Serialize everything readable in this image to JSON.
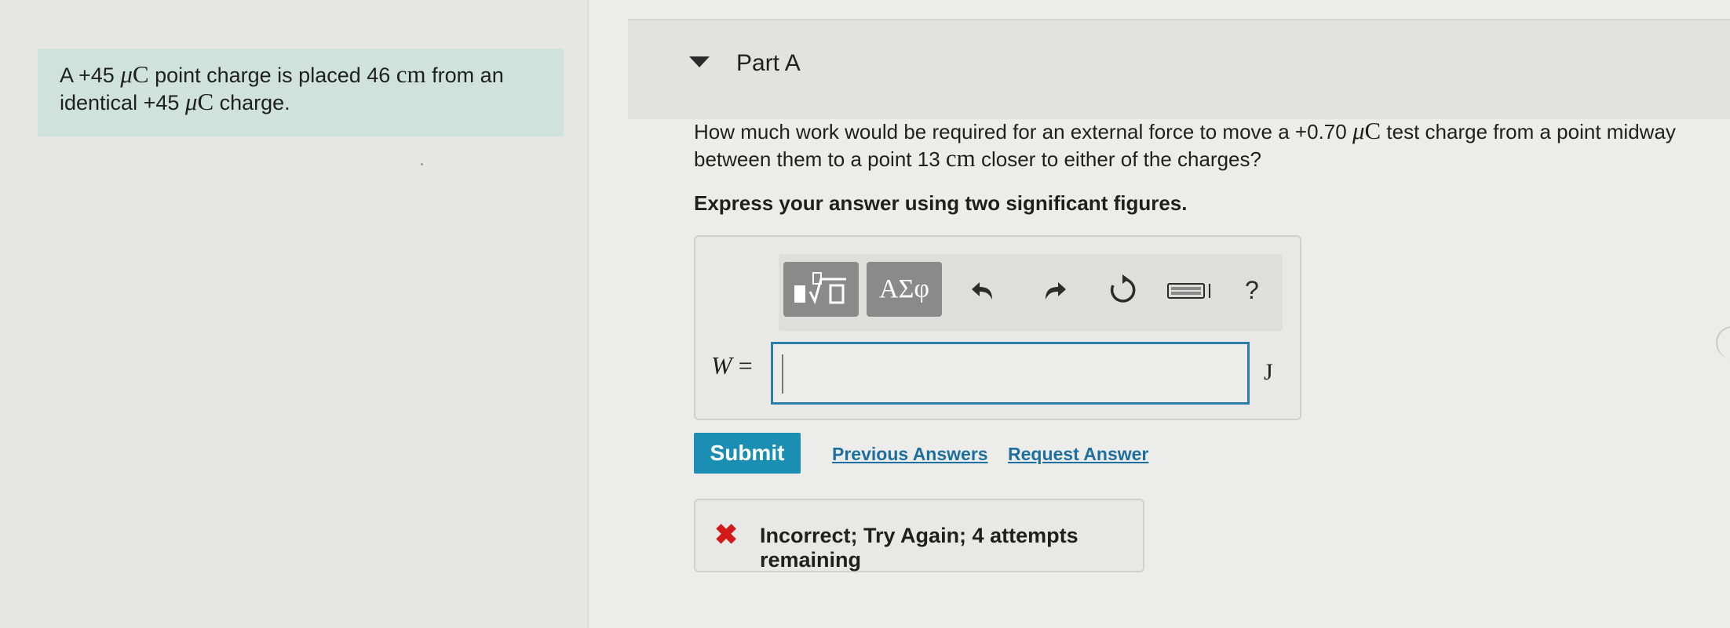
{
  "problem": {
    "part1": "A +45 ",
    "mu1": "μ",
    "unit1": "C",
    "part2": " point charge is placed 46 ",
    "cm1": "cm",
    "part3": " from an identical +45 ",
    "mu2": "μ",
    "unit2": "C",
    "part4": " charge."
  },
  "part": {
    "title": "Part A"
  },
  "question": {
    "part1": "How much work would be required for an external force to move a +0.70 ",
    "mu": "μ",
    "unit": "C",
    "part2": " test charge from a point midway between them to a point 13 ",
    "cm": "cm",
    "part3": " closer to either of the charges?"
  },
  "instruction": "Express your answer using two significant figures.",
  "toolbar": {
    "greek_label": "ΑΣφ",
    "help_label": "?"
  },
  "answer": {
    "variable": "W",
    "equals": " =",
    "value": "",
    "unit": "J"
  },
  "actions": {
    "submit_label": "Submit",
    "previous_answers_label": "Previous Answers",
    "request_answer_label": "Request Answer"
  },
  "feedback": {
    "icon": "✖",
    "message": "Incorrect; Try Again; 4 attempts remaining",
    "status_color": "#d31a1a"
  },
  "colors": {
    "accent": "#1a8fb3",
    "link": "#1c6f9e",
    "problem_bg": "#cfe3dc",
    "input_border": "#2b7ea8"
  }
}
